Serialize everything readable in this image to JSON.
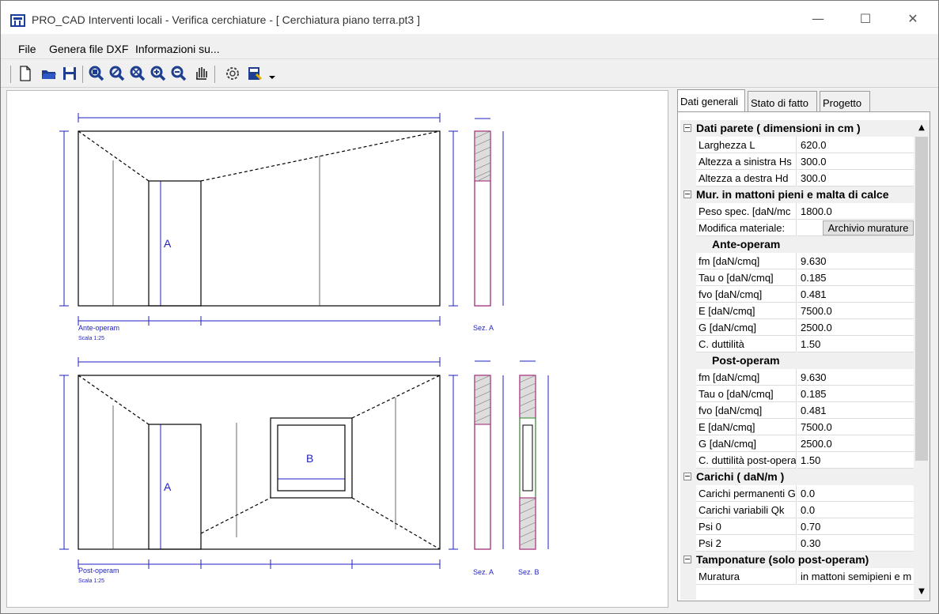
{
  "window": {
    "title": "PRO_CAD Interventi locali - Verifica cerchiature -  [ Cerchiatura piano terra.pt3 ]",
    "controls": {
      "minimize": "—",
      "maximize": "☐",
      "close": "✕"
    }
  },
  "menu": {
    "file": "File",
    "dxf": "Genera file DXF",
    "info": "Informazioni su..."
  },
  "toolbar": {
    "icons": [
      "new-file-icon",
      "open-folder-icon",
      "save-icon",
      "zoom-window-icon",
      "zoom-extents-icon",
      "zoom-all-icon",
      "zoom-in-icon",
      "zoom-out-icon",
      "pan-hand-icon",
      "settings-gear-icon",
      "calculate-icon",
      "dropdown-arrow-icon"
    ]
  },
  "drawing": {
    "ante": {
      "label": "Ante-operam",
      "scale": "Scala 1:25",
      "opening": "A",
      "section": "Sez. A"
    },
    "post": {
      "label": "Post-operam",
      "scale": "Scala 1:25",
      "opening_a": "A",
      "opening_b": "B",
      "section_a": "Sez. A",
      "section_b": "Sez. B"
    }
  },
  "tabs": {
    "general": "Dati generali",
    "existing": "Stato di fatto",
    "project": "Progetto"
  },
  "grid": {
    "cat_parete": "Dati parete    ( dimensioni in cm )",
    "larghezza_label": "Larghezza L",
    "larghezza_val": "620.0",
    "hs_label": "Altezza a sinistra Hs",
    "hs_val": "300.0",
    "hd_label": "Altezza a destra Hd",
    "hd_val": "300.0",
    "cat_muratura": "Mur. in mattoni pieni e malta di calce",
    "peso_label": "Peso spec. [daN/mc",
    "peso_val": "1800.0",
    "modifica_label": "Modifica materiale:",
    "modifica_button": "Archivio murature",
    "ante_header": "Ante-operam",
    "ante_fm_label": "fm  [daN/cmq]",
    "ante_fm_val": "9.630",
    "ante_tau_label": "Tau o  [daN/cmq]",
    "ante_tau_val": "0.185",
    "ante_fvo_label": "fvo  [daN/cmq]",
    "ante_fvo_val": "0.481",
    "ante_e_label": "E  [daN/cmq]",
    "ante_e_val": "7500.0",
    "ante_g_label": "G  [daN/cmq]",
    "ante_g_val": "2500.0",
    "ante_cd_label": "C. duttilità",
    "ante_cd_val": "1.50",
    "post_header": "Post-operam",
    "post_fm_label": "fm  [daN/cmq]",
    "post_fm_val": "9.630",
    "post_tau_label": "Tau o  [daN/cmq]",
    "post_tau_val": "0.185",
    "post_fvo_label": "fvo  [daN/cmq]",
    "post_fvo_val": "0.481",
    "post_e_label": "E  [daN/cmq]",
    "post_e_val": "7500.0",
    "post_g_label": "G  [daN/cmq]",
    "post_g_val": "2500.0",
    "post_cd_label": "C. duttilità post-opera",
    "post_cd_val": "1.50",
    "cat_carichi": "Carichi    ( daN/m )",
    "perm_label": "Carichi permanenti G",
    "perm_val": "0.0",
    "var_label": "Carichi variabili Qk",
    "var_val": "0.0",
    "psi0_label": "Psi 0",
    "psi0_val": "0.70",
    "psi2_label": "Psi 2",
    "psi2_val": "0.30",
    "cat_tamponature": "Tamponature (solo post-operam)",
    "muratura_label": "Muratura",
    "muratura_val": "in mattoni semipieni e m"
  },
  "scrollbar": {
    "up": "▲",
    "down": "▼"
  },
  "colors": {
    "accent": "#1a3e9c",
    "drawing_blue": "#1f1fbf",
    "section": "#9b1c6e"
  }
}
